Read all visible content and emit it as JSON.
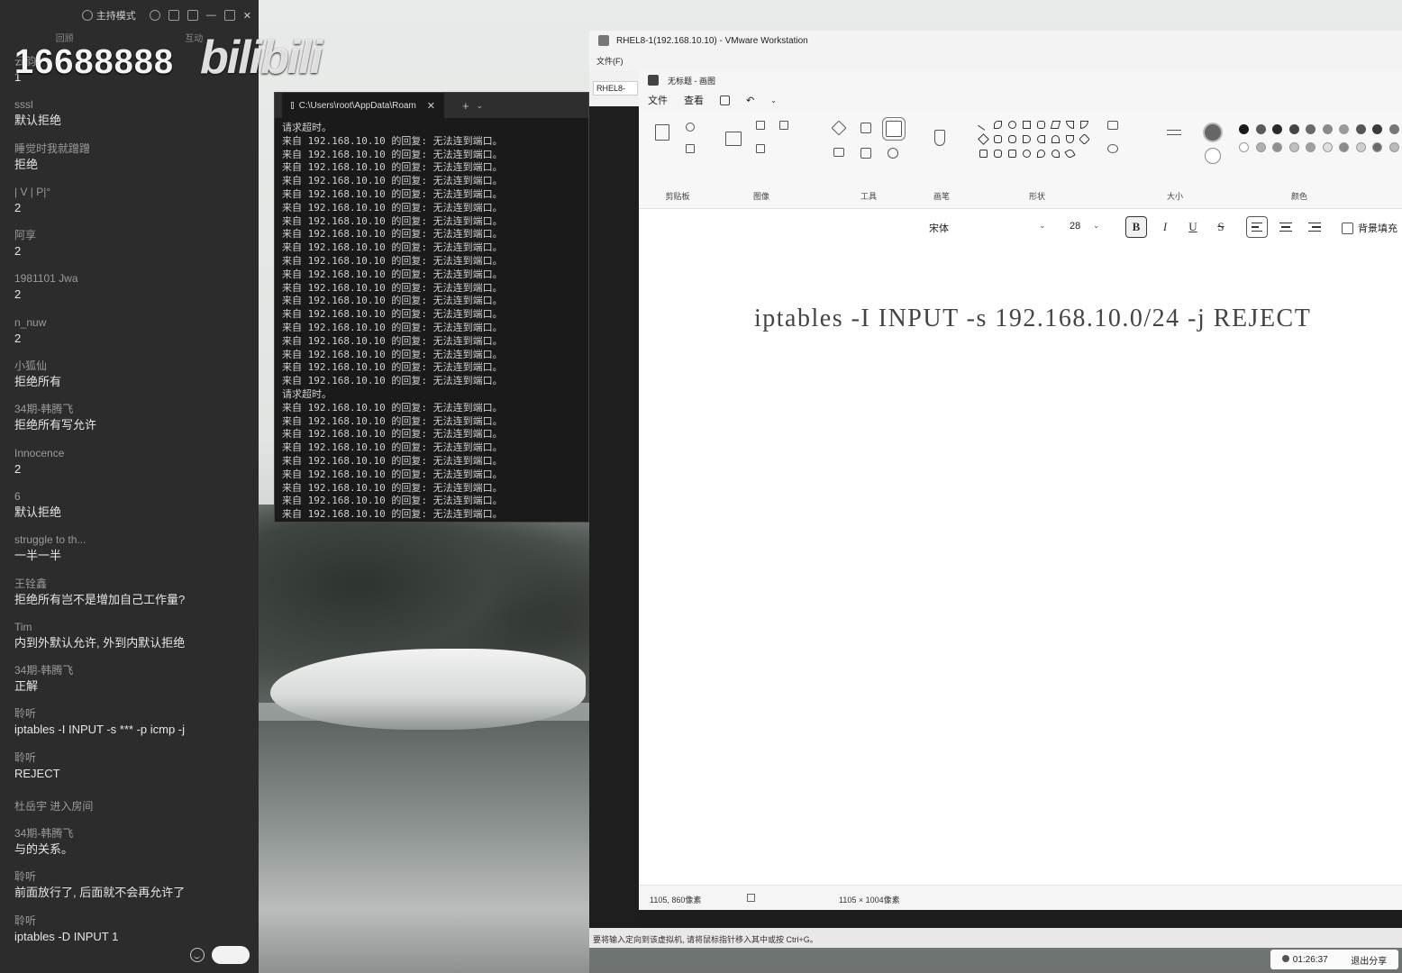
{
  "live_panel": {
    "mode_label": "主持模式",
    "tabs": [
      "回顾",
      "互动"
    ],
    "watermark_number": "16688888",
    "watermark_logo": "bilibili",
    "messages": [
      {
        "user": "云韵",
        "text": "1"
      },
      {
        "user": "sssl",
        "text": "默认拒绝"
      },
      {
        "user": "睡觉时我就蹭蹭",
        "text": "拒绝"
      },
      {
        "user": "| V | P|°",
        "text": "2"
      },
      {
        "user": "阿享",
        "text": "2"
      },
      {
        "user": "1981101 Jwa",
        "text": "2"
      },
      {
        "user": "n_nuw",
        "text": "2"
      },
      {
        "user": "小狐仙",
        "text": "拒绝所有"
      },
      {
        "user": "34期-韩腾飞",
        "text": "拒绝所有写允许"
      },
      {
        "user": "Innocence",
        "text": "2"
      },
      {
        "user": "6",
        "text": "默认拒绝"
      },
      {
        "user": "struggle to th...",
        "text": "一半一半"
      },
      {
        "user": "王铨鑫",
        "text": "拒绝所有岂不是增加自己工作量?"
      },
      {
        "user": "Tim",
        "text": "内到外默认允许, 外到内默认拒绝"
      },
      {
        "user": "34期-韩腾飞",
        "text": "正解"
      },
      {
        "user": "聆听",
        "text": "iptables -I INPUT -s *** -p icmp -j"
      },
      {
        "user": "聆听",
        "text": "REJECT"
      },
      {
        "user": "杜岳宇 进入房间",
        "text": ""
      },
      {
        "user": "34期-韩腾飞",
        "text": "与的关系。"
      },
      {
        "user": "聆听",
        "text": "前面放行了, 后面就不会再允许了"
      },
      {
        "user": "聆听",
        "text": "iptables -D INPUT 1"
      }
    ]
  },
  "console": {
    "tab_title": "C:\\Users\\root\\AppData\\Roam",
    "lines": [
      "请求超时。",
      "来自 192.168.10.10 的回复: 无法连到端口。",
      "来自 192.168.10.10 的回复: 无法连到端口。",
      "来自 192.168.10.10 的回复: 无法连到端口。",
      "来自 192.168.10.10 的回复: 无法连到端口。",
      "来自 192.168.10.10 的回复: 无法连到端口。",
      "来自 192.168.10.10 的回复: 无法连到端口。",
      "来自 192.168.10.10 的回复: 无法连到端口。",
      "来自 192.168.10.10 的回复: 无法连到端口。",
      "来自 192.168.10.10 的回复: 无法连到端口。",
      "来自 192.168.10.10 的回复: 无法连到端口。",
      "来自 192.168.10.10 的回复: 无法连到端口。",
      "来自 192.168.10.10 的回复: 无法连到端口。",
      "来自 192.168.10.10 的回复: 无法连到端口。",
      "来自 192.168.10.10 的回复: 无法连到端口。",
      "来自 192.168.10.10 的回复: 无法连到端口。",
      "来自 192.168.10.10 的回复: 无法连到端口。",
      "来自 192.168.10.10 的回复: 无法连到端口。",
      "来自 192.168.10.10 的回复: 无法连到端口。",
      "来自 192.168.10.10 的回复: 无法连到端口。",
      "请求超时。",
      "来自 192.168.10.10 的回复: 无法连到端口。",
      "来自 192.168.10.10 的回复: 无法连到端口。",
      "来自 192.168.10.10 的回复: 无法连到端口。",
      "来自 192.168.10.10 的回复: 无法连到端口。",
      "来自 192.168.10.10 的回复: 无法连到端口。",
      "来自 192.168.10.10 的回复: 无法连到端口。",
      "来自 192.168.10.10 的回复: 无法连到端口。",
      "来自 192.168.10.10 的回复: 无法连到端口。",
      "来自 192.168.10.10 的回复: 无法连到端口。"
    ]
  },
  "vmware": {
    "title": "RHEL8-1(192.168.10.10) - VMware Workstation",
    "menu": [
      "文件(F)"
    ],
    "vm_tab": "RHEL8-",
    "status_text": "要将输入定向到该虚拟机, 请将鼠标指针移入其中或按 Ctrl+G。"
  },
  "paint": {
    "title": "无标题 - 画图",
    "menu": [
      "文件",
      "查看"
    ],
    "groups": [
      "剪贴板",
      "图像",
      "工具",
      "画笔",
      "形状",
      "大小",
      "颜色"
    ],
    "font_name": "宋体",
    "font_size": "28",
    "format_buttons": [
      "B",
      "I",
      "U",
      "S"
    ],
    "fill_label": "背景填充",
    "canvas_text": "iptables -I INPUT -s 192.168.10.0/24 -j REJECT",
    "status_cursor": "1105, 860像素",
    "status_size": "1105 × 1004像素"
  },
  "share_bar": {
    "timer": "01:26:37",
    "end_label": "退出分享"
  },
  "palette": [
    "#1a1a1a",
    "#5a5a5a",
    "#2a2a2a",
    "#444444",
    "#6a6a6a",
    "#8a8a8a",
    "#9a9a9a",
    "#555555",
    "#3a3a3a",
    "#777777"
  ],
  "palette2": [
    "#ffffff",
    "#b0b0b0",
    "#909090",
    "#c0c0c0",
    "#a0a0a0",
    "#e0e0e0",
    "#8a8a8a",
    "#d0d0d0",
    "#6a6a6a",
    "#bbbbbb"
  ]
}
